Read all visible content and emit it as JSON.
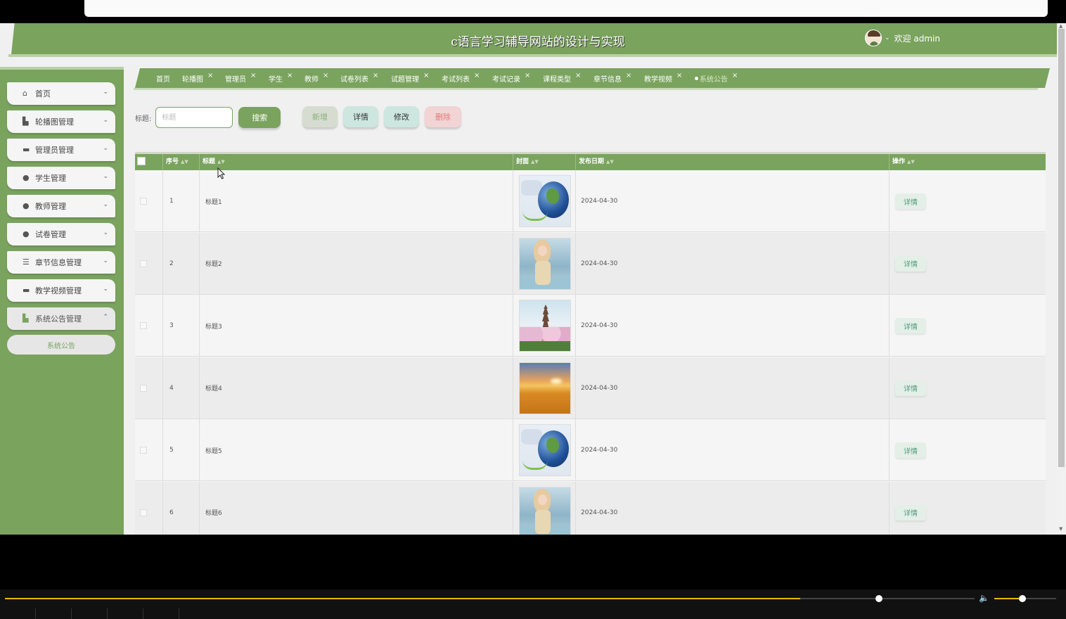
{
  "site": {
    "title": "c语言学习辅导网站的设计与实现",
    "welcome": "欢迎 admin"
  },
  "sidebar": {
    "items": [
      {
        "label": "首页",
        "icon": "home-icon",
        "expanded": false
      },
      {
        "label": "轮播图管理",
        "icon": "carousel-icon",
        "expanded": false
      },
      {
        "label": "管理员管理",
        "icon": "admin-icon",
        "expanded": false
      },
      {
        "label": "学生管理",
        "icon": "student-icon",
        "expanded": false
      },
      {
        "label": "教师管理",
        "icon": "teacher-icon",
        "expanded": false
      },
      {
        "label": "试卷管理",
        "icon": "exam-paper-icon",
        "expanded": false
      },
      {
        "label": "章节信息管理",
        "icon": "chapter-icon",
        "expanded": false
      },
      {
        "label": "教学视频管理",
        "icon": "video-icon",
        "expanded": false
      },
      {
        "label": "系统公告管理",
        "icon": "notice-icon",
        "expanded": true
      }
    ],
    "submenu": {
      "label": "系统公告"
    }
  },
  "tabs": [
    {
      "label": "首页",
      "closable": false
    },
    {
      "label": "轮播图",
      "closable": true
    },
    {
      "label": "管理员",
      "closable": true
    },
    {
      "label": "学生",
      "closable": true
    },
    {
      "label": "教师",
      "closable": true
    },
    {
      "label": "试卷列表",
      "closable": true
    },
    {
      "label": "试题管理",
      "closable": true
    },
    {
      "label": "考试列表",
      "closable": true
    },
    {
      "label": "考试记录",
      "closable": true
    },
    {
      "label": "课程类型",
      "closable": true
    },
    {
      "label": "章节信息",
      "closable": true
    },
    {
      "label": "教学视频",
      "closable": true
    },
    {
      "label": "系统公告",
      "closable": true,
      "active": true
    }
  ],
  "toolbar": {
    "search_label": "标题:",
    "search_placeholder": "标题",
    "search_button": "搜索",
    "add_button": "新增",
    "detail_button": "详情",
    "edit_button": "修改",
    "delete_button": "删除"
  },
  "table": {
    "columns": [
      "序号",
      "标题",
      "封面",
      "发布日期",
      "操作"
    ],
    "rows": [
      {
        "index": "1",
        "title": "标题1",
        "cover": "earth",
        "date": "2024-04-30",
        "action": "详情"
      },
      {
        "index": "2",
        "title": "标题2",
        "cover": "girl",
        "date": "2024-04-30",
        "action": "详情"
      },
      {
        "index": "3",
        "title": "标题3",
        "cover": "pagoda",
        "date": "2024-04-30",
        "action": "详情"
      },
      {
        "index": "4",
        "title": "标题4",
        "cover": "field",
        "date": "2024-04-30",
        "action": "详情"
      },
      {
        "index": "5",
        "title": "标题5",
        "cover": "earth",
        "date": "2024-04-30",
        "action": "详情"
      },
      {
        "index": "6",
        "title": "标题6",
        "cover": "girl",
        "date": "2024-04-30",
        "action": "详情"
      }
    ]
  },
  "player": {
    "progress": 0.82,
    "volume": 0.45
  },
  "colors": {
    "primary": "#7aa35e",
    "primary_light": "#b9d0a6",
    "danger": "#e37a7a",
    "info": "#4f9a7a"
  }
}
